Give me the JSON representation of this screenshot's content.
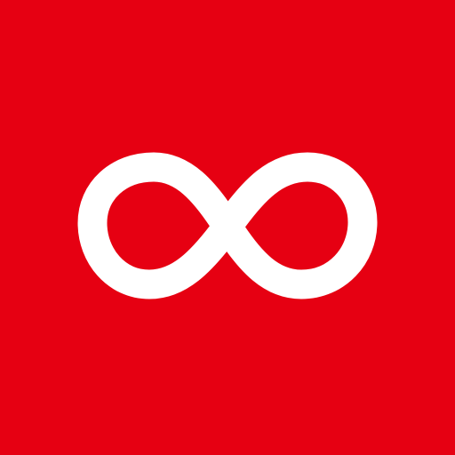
{
  "app_icon": {
    "background_color": "#E60012",
    "foreground_color": "#FFFFFF",
    "icon": "infinity-icon"
  }
}
